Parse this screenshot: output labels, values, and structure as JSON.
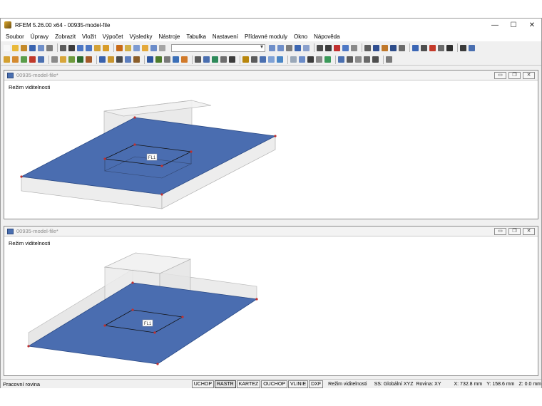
{
  "window": {
    "title": "RFEM 5.26.00 x64 - 00935-model-file",
    "controls": {
      "minimize": "—",
      "maximize": "☐",
      "close": "✕"
    }
  },
  "menu": [
    "Soubor",
    "Úpravy",
    "Zobrazit",
    "Vložit",
    "Výpočet",
    "Výsledky",
    "Nástroje",
    "Tabulka",
    "Nastavení",
    "Přídavné moduly",
    "Okno",
    "Nápověda"
  ],
  "toolbar1_colors": [
    "#f8f8f8",
    "#e9b93a",
    "#c48a2a",
    "#3a64b0",
    "#6f8fc9",
    "#7e7e7e",
    "#5d5d5d",
    "#3c3c3c",
    "#4d77c4",
    "#4d77c4",
    "#d3a237",
    "#d89c2a",
    "#c86a17",
    "#d2b048",
    "#7d9bd1",
    "#e4a93b",
    "#6b8cc9",
    "#a5a5a5"
  ],
  "toolbar1_right_colors": [
    "#6f8fc9",
    "#6f8fc9",
    "#7d7d7d",
    "#3d67b2",
    "#8aa0cc",
    "#4b4b4b",
    "#3c3c3c",
    "#c13030",
    "#4e78c5",
    "#8a8a8a",
    "#5f5f5f",
    "#314f91",
    "#c0782a",
    "#2e4d8a",
    "#6b6b6b",
    "#3b66b5",
    "#4e4e4e",
    "#c43a2a",
    "#6a6a6a",
    "#2e2e2e",
    "#3b3b3b",
    "#4a6fb0"
  ],
  "toolbar2_colors": [
    "#d4a030",
    "#d48a30",
    "#5a9d4a",
    "#c0392b",
    "#4a6fb0",
    "#8a8a8a",
    "#d8a63a",
    "#6c9a3c",
    "#2e6b2e",
    "#a45a2a",
    "#3a62ad",
    "#c8952e",
    "#4a4a4a",
    "#5d7fbf",
    "#8b5e2a",
    "#2c55a0",
    "#4d7b2c",
    "#7a7a7a",
    "#3b6fb7",
    "#d17a2a",
    "#5a5a5a",
    "#4a6fb0",
    "#2e8a5a",
    "#6d6d6d",
    "#3c3c3c",
    "#b8860b",
    "#5c5c5c",
    "#4a6fb0",
    "#7fa2d6",
    "#4a86c5",
    "#9aa8b8",
    "#6b8cc9",
    "#3d3d3d",
    "#8a8a8a",
    "#3b9a5a",
    "#4a6fb0",
    "#5b5b5b",
    "#8c8c8c",
    "#6a6a6a",
    "#4e4e4e",
    "#7a7a7a"
  ],
  "views": [
    {
      "title": "00935-model-file*",
      "mode_label": "Režim viditelnosti",
      "surface_label": "FL1"
    },
    {
      "title": "00935-model-file*",
      "mode_label": "Režim viditelnosti",
      "surface_label": "FL1"
    }
  ],
  "mdi_buttons": {
    "minimize": "▭",
    "restore": "❐",
    "close": "✕"
  },
  "colors": {
    "slab": "#4a6db0",
    "slab_edge": "#2a4a86",
    "side": "#ededed",
    "node": "#c03030"
  },
  "status": {
    "left": "Pracovní rovina",
    "toggles": [
      "UCHOP",
      "RASTR",
      "KARTEZ",
      "OUCHOP",
      "VLINIE",
      "DXF"
    ],
    "active_toggles": [
      "RASTR"
    ],
    "mode": "Režim viditelnosti",
    "system": "SS: Globální XYZ",
    "plane": "Rovina: XY",
    "x": "X:  732.8 mm",
    "y": "Y:  158.6 mm",
    "z": "Z:  0.0 mm"
  }
}
